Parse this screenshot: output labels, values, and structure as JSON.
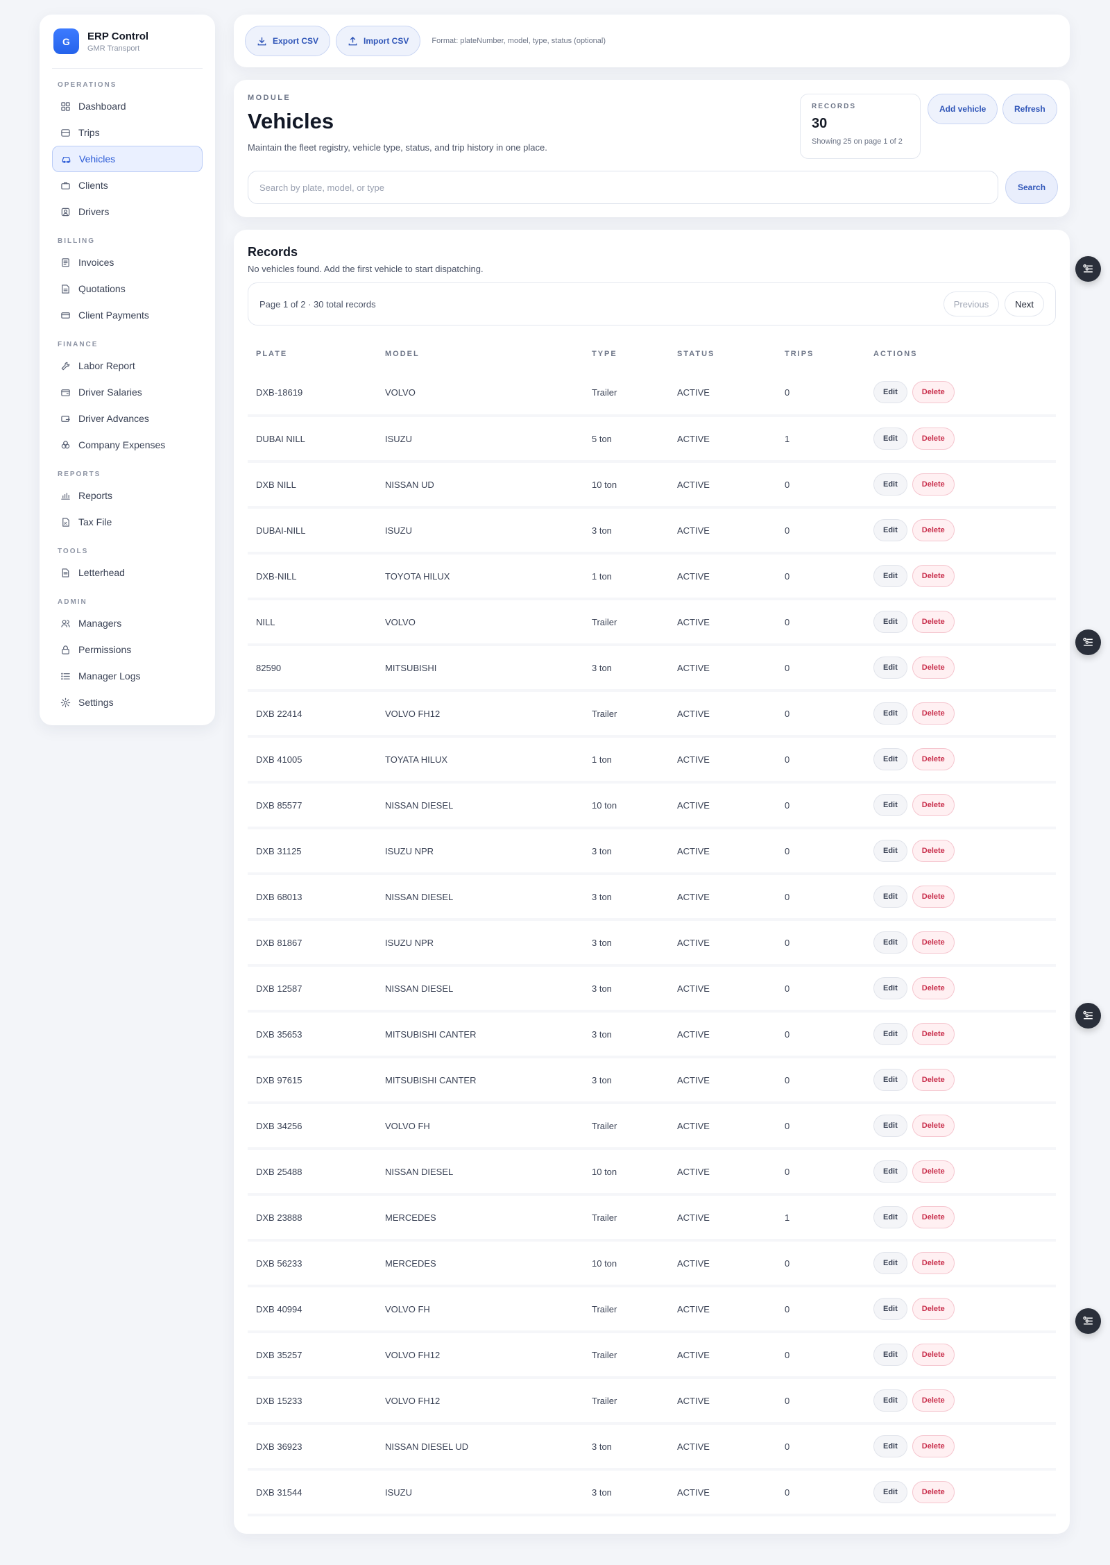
{
  "brand": {
    "initial": "G",
    "name": "ERP Control",
    "sub": "GMR Transport"
  },
  "sidebar": {
    "sections": [
      {
        "title": "Operations",
        "items": [
          {
            "label": "Dashboard",
            "icon": "grid-icon"
          },
          {
            "label": "Trips",
            "icon": "route-icon"
          },
          {
            "label": "Vehicles",
            "icon": "car-icon",
            "active": true
          },
          {
            "label": "Clients",
            "icon": "briefcase-icon"
          },
          {
            "label": "Drivers",
            "icon": "id-card-icon"
          }
        ]
      },
      {
        "title": "Billing",
        "items": [
          {
            "label": "Invoices",
            "icon": "invoice-icon"
          },
          {
            "label": "Quotations",
            "icon": "quote-icon"
          },
          {
            "label": "Client Payments",
            "icon": "card-icon"
          }
        ]
      },
      {
        "title": "Finance",
        "items": [
          {
            "label": "Labor Report",
            "icon": "wrench-icon"
          },
          {
            "label": "Driver Salaries",
            "icon": "wallet-icon"
          },
          {
            "label": "Driver Advances",
            "icon": "advance-icon"
          },
          {
            "label": "Company Expenses",
            "icon": "coins-icon"
          }
        ]
      },
      {
        "title": "Reports",
        "items": [
          {
            "label": "Reports",
            "icon": "chart-icon"
          },
          {
            "label": "Tax File",
            "icon": "tax-file-icon"
          }
        ]
      },
      {
        "title": "Tools",
        "items": [
          {
            "label": "Letterhead",
            "icon": "document-icon"
          }
        ]
      },
      {
        "title": "Admin",
        "items": [
          {
            "label": "Managers",
            "icon": "users-icon"
          },
          {
            "label": "Permissions",
            "icon": "lock-icon"
          },
          {
            "label": "Manager Logs",
            "icon": "list-icon"
          },
          {
            "label": "Settings",
            "icon": "gear-icon"
          }
        ]
      }
    ]
  },
  "toolbar": {
    "export_label": "Export CSV",
    "import_label": "Import CSV",
    "format_hint": "Format: plateNumber, model, type, status (optional)"
  },
  "module": {
    "kicker": "MODULE",
    "title": "Vehicles",
    "description": "Maintain the fleet registry, vehicle type, status, and trip history in one place.",
    "stat_label": "RECORDS",
    "stat_value": "30",
    "stat_sub": "Showing 25 on page 1 of 2",
    "add_label": "Add vehicle",
    "refresh_label": "Refresh",
    "search_placeholder": "Search by plate, model, or type",
    "search_label": "Search"
  },
  "records": {
    "title": "Records",
    "subtitle": "No vehicles found. Add the first vehicle to start dispatching.",
    "page_info": "Page 1 of 2 · 30 total records",
    "prev_label": "Previous",
    "next_label": "Next",
    "columns": [
      "PLATE",
      "MODEL",
      "TYPE",
      "STATUS",
      "TRIPS",
      "ACTIONS"
    ],
    "edit_label": "Edit",
    "delete_label": "Delete",
    "rows": [
      {
        "plate": "DXB-18619",
        "model": "VOLVO",
        "type": "Trailer",
        "status": "ACTIVE",
        "trips": "0"
      },
      {
        "plate": "DUBAI NILL",
        "model": "ISUZU",
        "type": "5 ton",
        "status": "ACTIVE",
        "trips": "1"
      },
      {
        "plate": "DXB NILL",
        "model": "NISSAN UD",
        "type": "10 ton",
        "status": "ACTIVE",
        "trips": "0"
      },
      {
        "plate": "DUBAI-NILL",
        "model": "ISUZU",
        "type": "3 ton",
        "status": "ACTIVE",
        "trips": "0"
      },
      {
        "plate": "DXB-NILL",
        "model": "TOYOTA HILUX",
        "type": "1 ton",
        "status": "ACTIVE",
        "trips": "0"
      },
      {
        "plate": "NILL",
        "model": "VOLVO",
        "type": "Trailer",
        "status": "ACTIVE",
        "trips": "0"
      },
      {
        "plate": "82590",
        "model": "MITSUBISHI",
        "type": "3 ton",
        "status": "ACTIVE",
        "trips": "0"
      },
      {
        "plate": "DXB 22414",
        "model": "VOLVO FH12",
        "type": "Trailer",
        "status": "ACTIVE",
        "trips": "0"
      },
      {
        "plate": "DXB 41005",
        "model": "TOYATA HILUX",
        "type": "1 ton",
        "status": "ACTIVE",
        "trips": "0"
      },
      {
        "plate": "DXB 85577",
        "model": "NISSAN DIESEL",
        "type": "10 ton",
        "status": "ACTIVE",
        "trips": "0"
      },
      {
        "plate": "DXB 31125",
        "model": "ISUZU NPR",
        "type": "3 ton",
        "status": "ACTIVE",
        "trips": "0"
      },
      {
        "plate": "DXB 68013",
        "model": "NISSAN DIESEL",
        "type": "3 ton",
        "status": "ACTIVE",
        "trips": "0"
      },
      {
        "plate": "DXB 81867",
        "model": "ISUZU NPR",
        "type": "3 ton",
        "status": "ACTIVE",
        "trips": "0"
      },
      {
        "plate": "DXB 12587",
        "model": "NISSAN DIESEL",
        "type": "3 ton",
        "status": "ACTIVE",
        "trips": "0"
      },
      {
        "plate": "DXB 35653",
        "model": "MITSUBISHI CANTER",
        "type": "3 ton",
        "status": "ACTIVE",
        "trips": "0"
      },
      {
        "plate": "DXB 97615",
        "model": "MITSUBISHI CANTER",
        "type": "3 ton",
        "status": "ACTIVE",
        "trips": "0"
      },
      {
        "plate": "DXB 34256",
        "model": "VOLVO FH",
        "type": "Trailer",
        "status": "ACTIVE",
        "trips": "0"
      },
      {
        "plate": "DXB 25488",
        "model": "NISSAN DIESEL",
        "type": "10 ton",
        "status": "ACTIVE",
        "trips": "0"
      },
      {
        "plate": "DXB 23888",
        "model": "MERCEDES",
        "type": "Trailer",
        "status": "ACTIVE",
        "trips": "1"
      },
      {
        "plate": "DXB 56233",
        "model": "MERCEDES",
        "type": "10 ton",
        "status": "ACTIVE",
        "trips": "0"
      },
      {
        "plate": "DXB 40994",
        "model": "VOLVO FH",
        "type": "Trailer",
        "status": "ACTIVE",
        "trips": "0"
      },
      {
        "plate": "DXB 35257",
        "model": "VOLVO FH12",
        "type": "Trailer",
        "status": "ACTIVE",
        "trips": "0"
      },
      {
        "plate": "DXB 15233",
        "model": "VOLVO FH12",
        "type": "Trailer",
        "status": "ACTIVE",
        "trips": "0"
      },
      {
        "plate": "DXB 36923",
        "model": "NISSAN DIESEL UD",
        "type": "3 ton",
        "status": "ACTIVE",
        "trips": "0"
      },
      {
        "plate": "DXB 31544",
        "model": "ISUZU",
        "type": "3 ton",
        "status": "ACTIVE",
        "trips": "0"
      }
    ]
  },
  "floating_buttons": {
    "icon": "filter-settings-icon",
    "count": 4
  }
}
